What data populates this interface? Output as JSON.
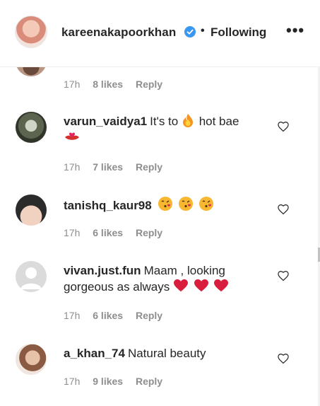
{
  "header": {
    "username": "kareenakapoorkhan",
    "separator": "•",
    "follow_status": "Following",
    "more_label": "•••"
  },
  "colors": {
    "verified": "#3897f0",
    "meta_text": "#8e8e8e",
    "heart_red": "#e0245e"
  },
  "comments": [
    {
      "username": "",
      "text": "",
      "time": "17h",
      "likes": "8 likes",
      "reply": "Reply"
    },
    {
      "username": "varun_vaidya1",
      "text": "It's to",
      "text_after": "hot bae",
      "emojis": [
        "fire",
        "kiss-lips-heart"
      ],
      "time": "17h",
      "likes": "7 likes",
      "reply": "Reply"
    },
    {
      "username": "tanishq_kaur98",
      "text": "",
      "emojis": [
        "face-blowing-kiss",
        "face-blowing-kiss",
        "face-blowing-kiss"
      ],
      "time": "17h",
      "likes": "6 likes",
      "reply": "Reply"
    },
    {
      "username": "vivan.just.fun",
      "text": "Maam , looking",
      "text_line2": "gorgeous as always",
      "emojis": [
        "heart",
        "heart",
        "heart"
      ],
      "time": "17h",
      "likes": "6 likes",
      "reply": "Reply"
    },
    {
      "username": "a_khan_74",
      "text": "Natural beauty",
      "time": "17h",
      "likes": "9 likes",
      "reply": "Reply"
    }
  ]
}
